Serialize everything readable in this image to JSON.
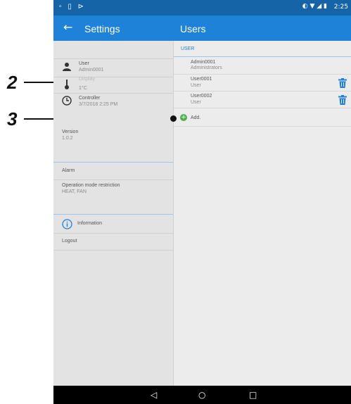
{
  "status_bar": {
    "time": "2:25"
  },
  "app_bar": {
    "back_glyph": "←",
    "settings_title": "Settings",
    "users_title": "Users"
  },
  "left_pane": {
    "user": {
      "label": "User",
      "value": "Admin0001"
    },
    "display": {
      "label": "Display",
      "value": "1°C"
    },
    "controller": {
      "label": "Controller",
      "value": "3/7/2018 2:25 PM"
    },
    "version": {
      "label": "Version",
      "value": "1.0.2"
    },
    "alarm": {
      "label": "Alarm"
    },
    "operation_mode": {
      "label": "Operation mode restriction",
      "value": "HEAT, FAN"
    },
    "information": {
      "label": "Information"
    },
    "logout": {
      "label": "Logout"
    }
  },
  "right_pane": {
    "section_header": "USER",
    "users": [
      {
        "name": "Admin0001",
        "role": "Administrators",
        "deletable": false
      },
      {
        "name": "User0001",
        "role": "User",
        "deletable": true
      },
      {
        "name": "User0002",
        "role": "User",
        "deletable": true
      }
    ],
    "add_label": "Add."
  },
  "callouts": [
    "2",
    "3"
  ],
  "colors": {
    "status_bar": "#1664a8",
    "app_bar": "#1e82d8",
    "accent": "#1e82d8",
    "add_green": "#4caf50"
  },
  "icons": [
    "back-arrow-icon",
    "user-icon",
    "thermometer-icon",
    "clock-icon",
    "info-icon",
    "trash-icon",
    "add-icon",
    "nav-back-icon",
    "nav-home-icon",
    "nav-recents-icon"
  ]
}
